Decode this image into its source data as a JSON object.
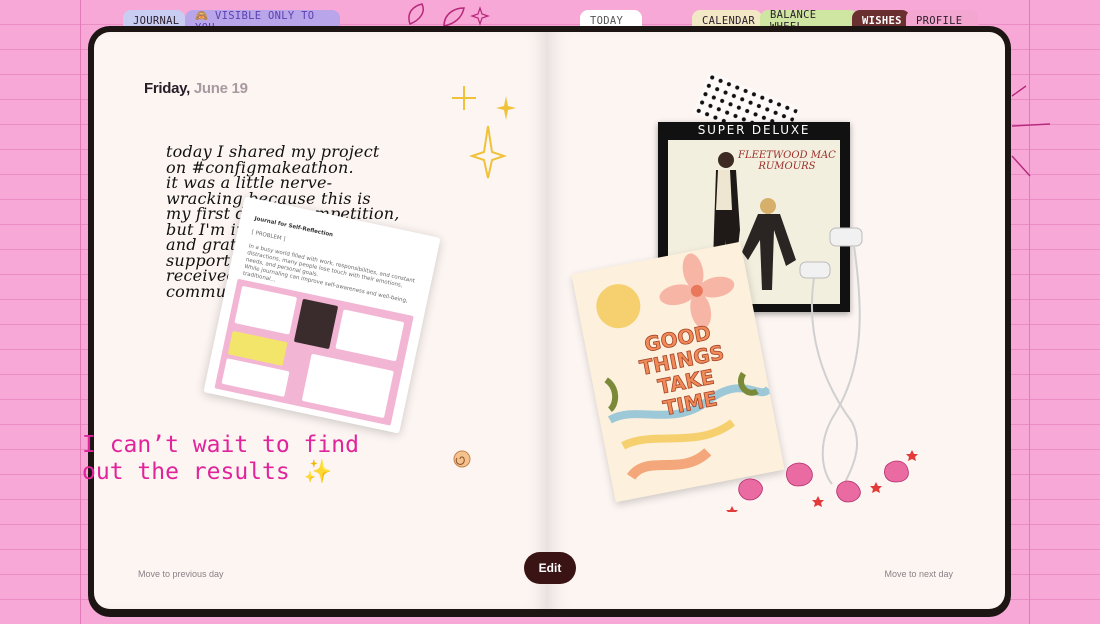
{
  "tabs": {
    "journal": "JOURNAL",
    "visible": "🙈 VISIBLE ONLY TO YOU",
    "today": "TODAY",
    "calendar": "CALENDAR",
    "balance": "BALANCE WHEEL",
    "wishes": "WISHES",
    "profile": "PROFILE"
  },
  "entry": {
    "weekday": "Friday,",
    "month_day": "June 19",
    "handwritten": "today I shared my project\non #configmakeathon.\nit was a little nerve-\nwracking because this is\nmy first design competition,\nbut I'm incredibly happy\nand grateful for all the\nsupport I've already\nreceived from the\ncommunity.",
    "message": "I can’t wait to find\nout the results ✨"
  },
  "card": {
    "header": "Journal for Self-Reflection",
    "label": "[ PROBLEM ]",
    "body": "In a busy world filled with work, responsibilities, and constant distractions, many people lose touch with their emotions, needs, and personal goals.\nWhile journaling can improve self-awareness and well-being, traditional..."
  },
  "album": {
    "title": "SUPER DELUXE",
    "band": "FLEETWOOD MAC",
    "name": "RUMOURS"
  },
  "poster": {
    "text": "GOOD\nTHINGS\nTAKE\nTIME"
  },
  "nav": {
    "prev": "Move to previous day",
    "next": "Move to next day"
  },
  "actions": {
    "edit": "Edit"
  }
}
